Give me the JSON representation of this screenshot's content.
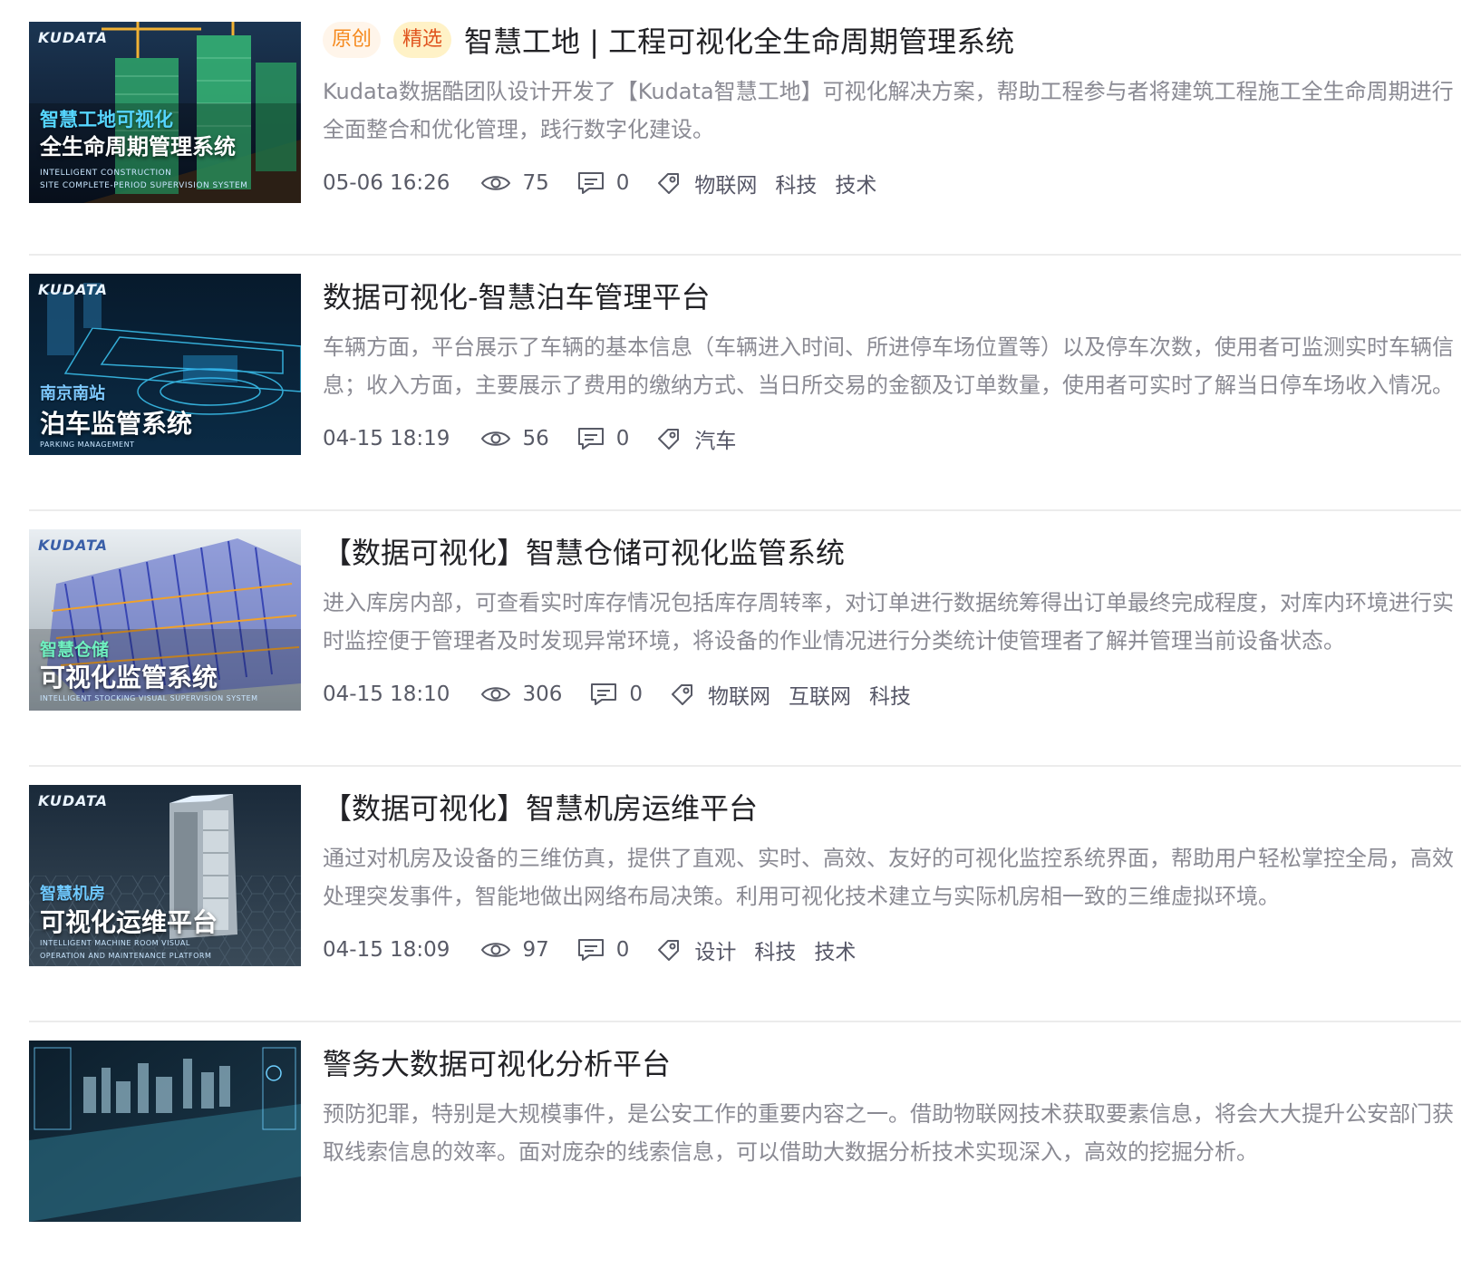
{
  "articles": [
    {
      "badges": [
        "原创",
        "精选"
      ],
      "title": "智慧工地 | 工程可视化全生命周期管理系统",
      "desc": "Kudata数据酷团队设计开发了【Kudata智慧工地】可视化解决方案，帮助工程参与者将建筑工程施工全生命周期进行全面整合和优化管理，践行数字化建设。",
      "date": "05-06 16:26",
      "views": "75",
      "comments": "0",
      "tags": [
        "物联网",
        "科技",
        "技术"
      ],
      "thumb": {
        "brand": "KUDATA",
        "sub": "智慧工地可视化",
        "main": "全生命周期管理系统",
        "en1": "INTELLIGENT CONSTRUCTION",
        "en2": "SITE COMPLETE-PERIOD SUPERVISION SYSTEM"
      }
    },
    {
      "badges": [],
      "title": "数据可视化-智慧泊车管理平台",
      "desc": "车辆方面，平台展示了车辆的基本信息（车辆进入时间、所进停车场位置等）以及停车次数，使用者可监测实时车辆信息；收入方面，主要展示了费用的缴纳方式、当日所交易的金额及订单数量，使用者可实时了解当日停车场收入情况。",
      "date": "04-15 18:19",
      "views": "56",
      "comments": "0",
      "tags": [
        "汽车"
      ],
      "thumb": {
        "brand": "KUDATA",
        "sub": "南京南站",
        "main": "泊车监管系统",
        "en1": "PARKING MANAGEMENT",
        "en2": ""
      }
    },
    {
      "badges": [],
      "title": "【数据可视化】智慧仓储可视化监管系统",
      "desc": "进入库房内部，可查看实时库存情况包括库存周转率，对订单进行数据统筹得出订单最终完成程度，对库内环境进行实时监控便于管理者及时发现异常环境，将设备的作业情况进行分类统计使管理者了解并管理当前设备状态。",
      "date": "04-15 18:10",
      "views": "306",
      "comments": "0",
      "tags": [
        "物联网",
        "互联网",
        "科技"
      ],
      "thumb": {
        "brand": "KUDATA",
        "sub": "智慧仓储",
        "main": "可视化监管系统",
        "en1": "INTELLIGENT STOCKING VISUAL SUPERVISION SYSTEM",
        "en2": ""
      }
    },
    {
      "badges": [],
      "title": "【数据可视化】智慧机房运维平台",
      "desc": "通过对机房及设备的三维仿真，提供了直观、实时、高效、友好的可视化监控系统界面，帮助用户轻松掌控全局，高效处理突发事件，智能地做出网络布局决策。利用可视化技术建立与实际机房相一致的三维虚拟环境。",
      "date": "04-15 18:09",
      "views": "97",
      "comments": "0",
      "tags": [
        "设计",
        "科技",
        "技术"
      ],
      "thumb": {
        "brand": "KUDATA",
        "sub": "智慧机房",
        "main": "可视化运维平台",
        "en1": "INTELLIGENT MACHINE ROOM VISUAL",
        "en2": "OPERATION AND MAINTENANCE PLATFORM"
      }
    },
    {
      "badges": [],
      "title": "警务大数据可视化分析平台",
      "desc": "预防犯罪，特别是大规模事件，是公安工作的重要内容之一。借助物联网技术获取要素信息，将会大大提升公安部门获取线索信息的效率。面对庞杂的线索信息，可以借助大数据分析技术实现深入，高效的挖掘分析。",
      "date": "",
      "views": "",
      "comments": "",
      "tags": [],
      "thumb": {
        "brand": "",
        "sub": "",
        "main": "",
        "en1": "",
        "en2": ""
      }
    }
  ],
  "colors": {
    "badge_original_text": "#f58a1f",
    "badge_pick_text": "#e0541e",
    "desc_text": "#8a8a93",
    "title_text": "#222226"
  }
}
